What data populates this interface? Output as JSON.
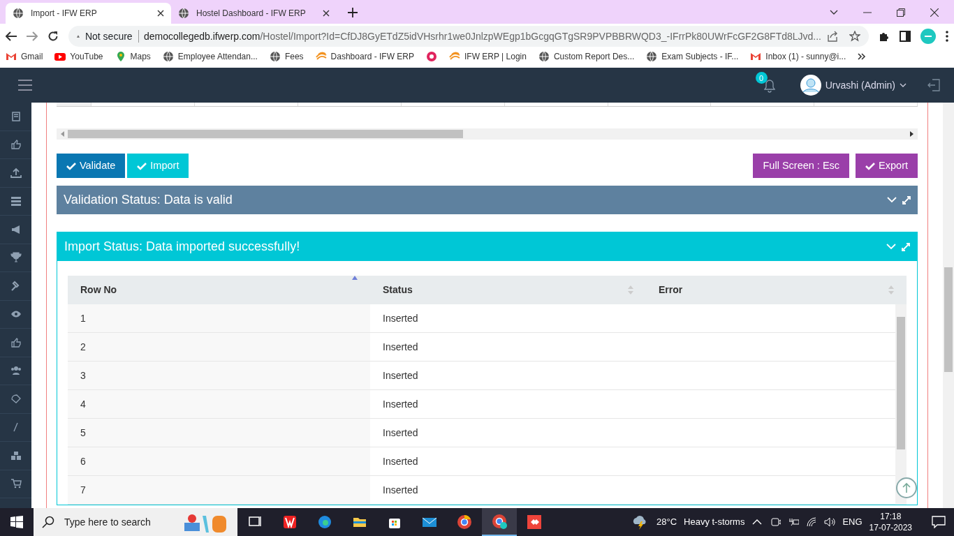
{
  "browser": {
    "tabs": [
      {
        "title": "Import - IFW ERP",
        "selected": true
      },
      {
        "title": "Hostel Dashboard - IFW ERP",
        "selected": false
      }
    ],
    "address": {
      "security": "Not secure",
      "host": "democollegedb.ifwerp.com",
      "path": "/Hostel/Import?Id=CfDJ8GyETdZ5idVHsrhr1we0JnlzpWEgp1bGcgqGTgSR9PVPBBRWQD3_-IFrrPk80UWrFcGF2G8FTd8LJvd..."
    },
    "bookmarks": [
      {
        "label": "Gmail",
        "kind": "gmail"
      },
      {
        "label": "YouTube",
        "kind": "youtube"
      },
      {
        "label": "Maps",
        "kind": "maps"
      },
      {
        "label": "Employee Attendan...",
        "kind": "globe"
      },
      {
        "label": "Fees",
        "kind": "globe"
      },
      {
        "label": "Dashboard - IFW ERP",
        "kind": "ifw"
      },
      {
        "kind": "red"
      },
      {
        "label": "IFW ERP | Login",
        "kind": "ifw"
      },
      {
        "label": "Custom Report Des...",
        "kind": "globe"
      },
      {
        "label": "Exam Subjects - IF...",
        "kind": "globe"
      },
      {
        "label": "Inbox (1) - sunny@i...",
        "kind": "gmail"
      }
    ]
  },
  "header": {
    "notification_count": "0",
    "user": "Urvashi (Admin)"
  },
  "buttons": [
    {
      "label": "Validate",
      "kind": "validate"
    },
    {
      "label": "Import",
      "kind": "import"
    },
    {
      "label": "Full Screen : Esc",
      "kind": "fullscreen"
    },
    {
      "label": "Export",
      "kind": "export"
    }
  ],
  "panels": [
    {
      "title": "Validation Status: Data is valid",
      "kind": "validation"
    },
    {
      "title": "Import Status: Data imported successfully!",
      "kind": "import"
    }
  ],
  "table": {
    "columns": [
      {
        "label": "Row No",
        "sorted": true
      },
      {
        "label": "Status",
        "sorted": false
      },
      {
        "label": "Error",
        "sorted": false
      }
    ],
    "rows": [
      [
        "1",
        "Inserted"
      ],
      [
        "2",
        "Inserted"
      ],
      [
        "3",
        "Inserted"
      ],
      [
        "4",
        "Inserted"
      ],
      [
        "5",
        "Inserted"
      ],
      [
        "6",
        "Inserted"
      ],
      [
        "7",
        "Inserted"
      ]
    ]
  },
  "taskbar": {
    "search_placeholder": "Type here to search",
    "temperature": "28°C",
    "weather": "Heavy t-storms",
    "language": "ENG",
    "time": "17:18",
    "date": "17-07-2023"
  }
}
